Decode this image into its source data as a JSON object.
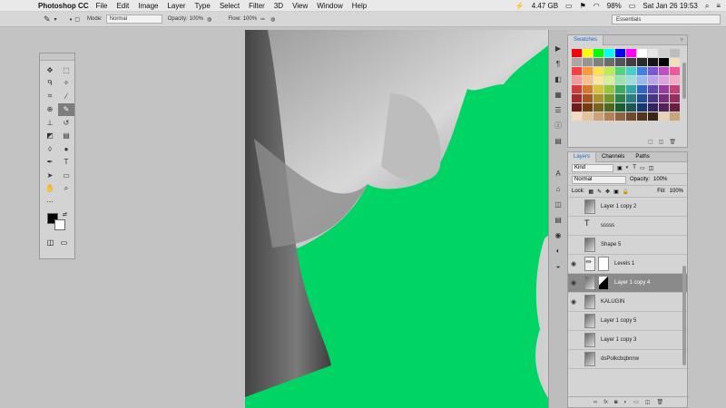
{
  "menubar": {
    "app": "Photoshop CC",
    "menus": [
      "File",
      "Edit",
      "Image",
      "Layer",
      "Type",
      "Select",
      "Filter",
      "3D",
      "View",
      "Window",
      "Help"
    ],
    "storage": "4.47 GB",
    "battery": "98%",
    "datetime": "Sat Jan 26 19:53"
  },
  "options": {
    "mode_label": "Mode:",
    "mode_value": "Normal",
    "opacity_label": "Opacity:",
    "opacity_value": "100%",
    "flow_label": "Flow:",
    "flow_value": "100%",
    "workspace": "Essentials"
  },
  "swatches": {
    "tab": "Swatches",
    "colors": [
      "#ff0000",
      "#ffff00",
      "#00ff00",
      "#00ffff",
      "#0000ff",
      "#ff00ff",
      "#ffffff",
      "#e6e6e6",
      "#d0d0d0",
      "#bdbdbd",
      "#a8a8a8",
      "#959595",
      "#808080",
      "#6b6b6b",
      "#555555",
      "#404040",
      "#2b2b2b",
      "#151515",
      "#000000",
      "#f0e0c0",
      "#ff4040",
      "#ff9a3c",
      "#ffe14a",
      "#bcec4e",
      "#4ed67a",
      "#45d0d0",
      "#3f7fe6",
      "#7a56d8",
      "#c04fc6",
      "#f05a9a",
      "#f59a9a",
      "#f8c08a",
      "#fbe89a",
      "#d7f09a",
      "#9ae0b0",
      "#9adede",
      "#9ab8ec",
      "#b8a6e6",
      "#dca4dc",
      "#f3aac8",
      "#d23c3c",
      "#d8782c",
      "#d8c03a",
      "#98c43c",
      "#3aaa60",
      "#34a7a7",
      "#3366c2",
      "#5f46b0",
      "#9a3e9e",
      "#c34078",
      "#a12a2a",
      "#a8561e",
      "#a8942a",
      "#74982e",
      "#2a844a",
      "#287f7f",
      "#244e96",
      "#483587",
      "#772f7a",
      "#962e5c",
      "#701c1c",
      "#753c14",
      "#75661c",
      "#4f6920",
      "#1c5c32",
      "#1c5858",
      "#193770",
      "#32255f",
      "#532155",
      "#68203f",
      "#f4dcc0",
      "#e4c29a",
      "#cca276",
      "#b08256",
      "#8e6440",
      "#6e4a2e",
      "#52361e",
      "#3a2412",
      "#e8d2b4",
      "#c8a67c"
    ]
  },
  "layers_panel": {
    "tabs": [
      "Layers",
      "Channels",
      "Paths"
    ],
    "kind": "Kind",
    "blend": "Normal",
    "opacity_label": "Opacity:",
    "opacity_value": "100%",
    "lock_label": "Lock:",
    "fill_label": "Fill:",
    "fill_value": "100%",
    "layers": [
      {
        "name": "Layer 1 copy 2",
        "visible": false,
        "selected": false
      },
      {
        "name": "sssss",
        "visible": false,
        "selected": false,
        "type": "text"
      },
      {
        "name": "Shape 5",
        "visible": false,
        "selected": false
      },
      {
        "name": "Levels 1",
        "visible": true,
        "selected": false,
        "type": "adjustment"
      },
      {
        "name": "Layer 1 copy 4",
        "visible": true,
        "selected": true
      },
      {
        "name": "KALUGIN",
        "visible": true,
        "selected": false
      },
      {
        "name": "Layer 1 copy 5",
        "visible": false,
        "selected": false
      },
      {
        "name": "Layer 1 copy 3",
        "visible": false,
        "selected": false
      },
      {
        "name": "dsPolkcbqbnnw",
        "visible": false,
        "selected": false
      }
    ]
  },
  "colors": {
    "canvas_bg": "#00d464",
    "accent": "#1a6bc9"
  }
}
